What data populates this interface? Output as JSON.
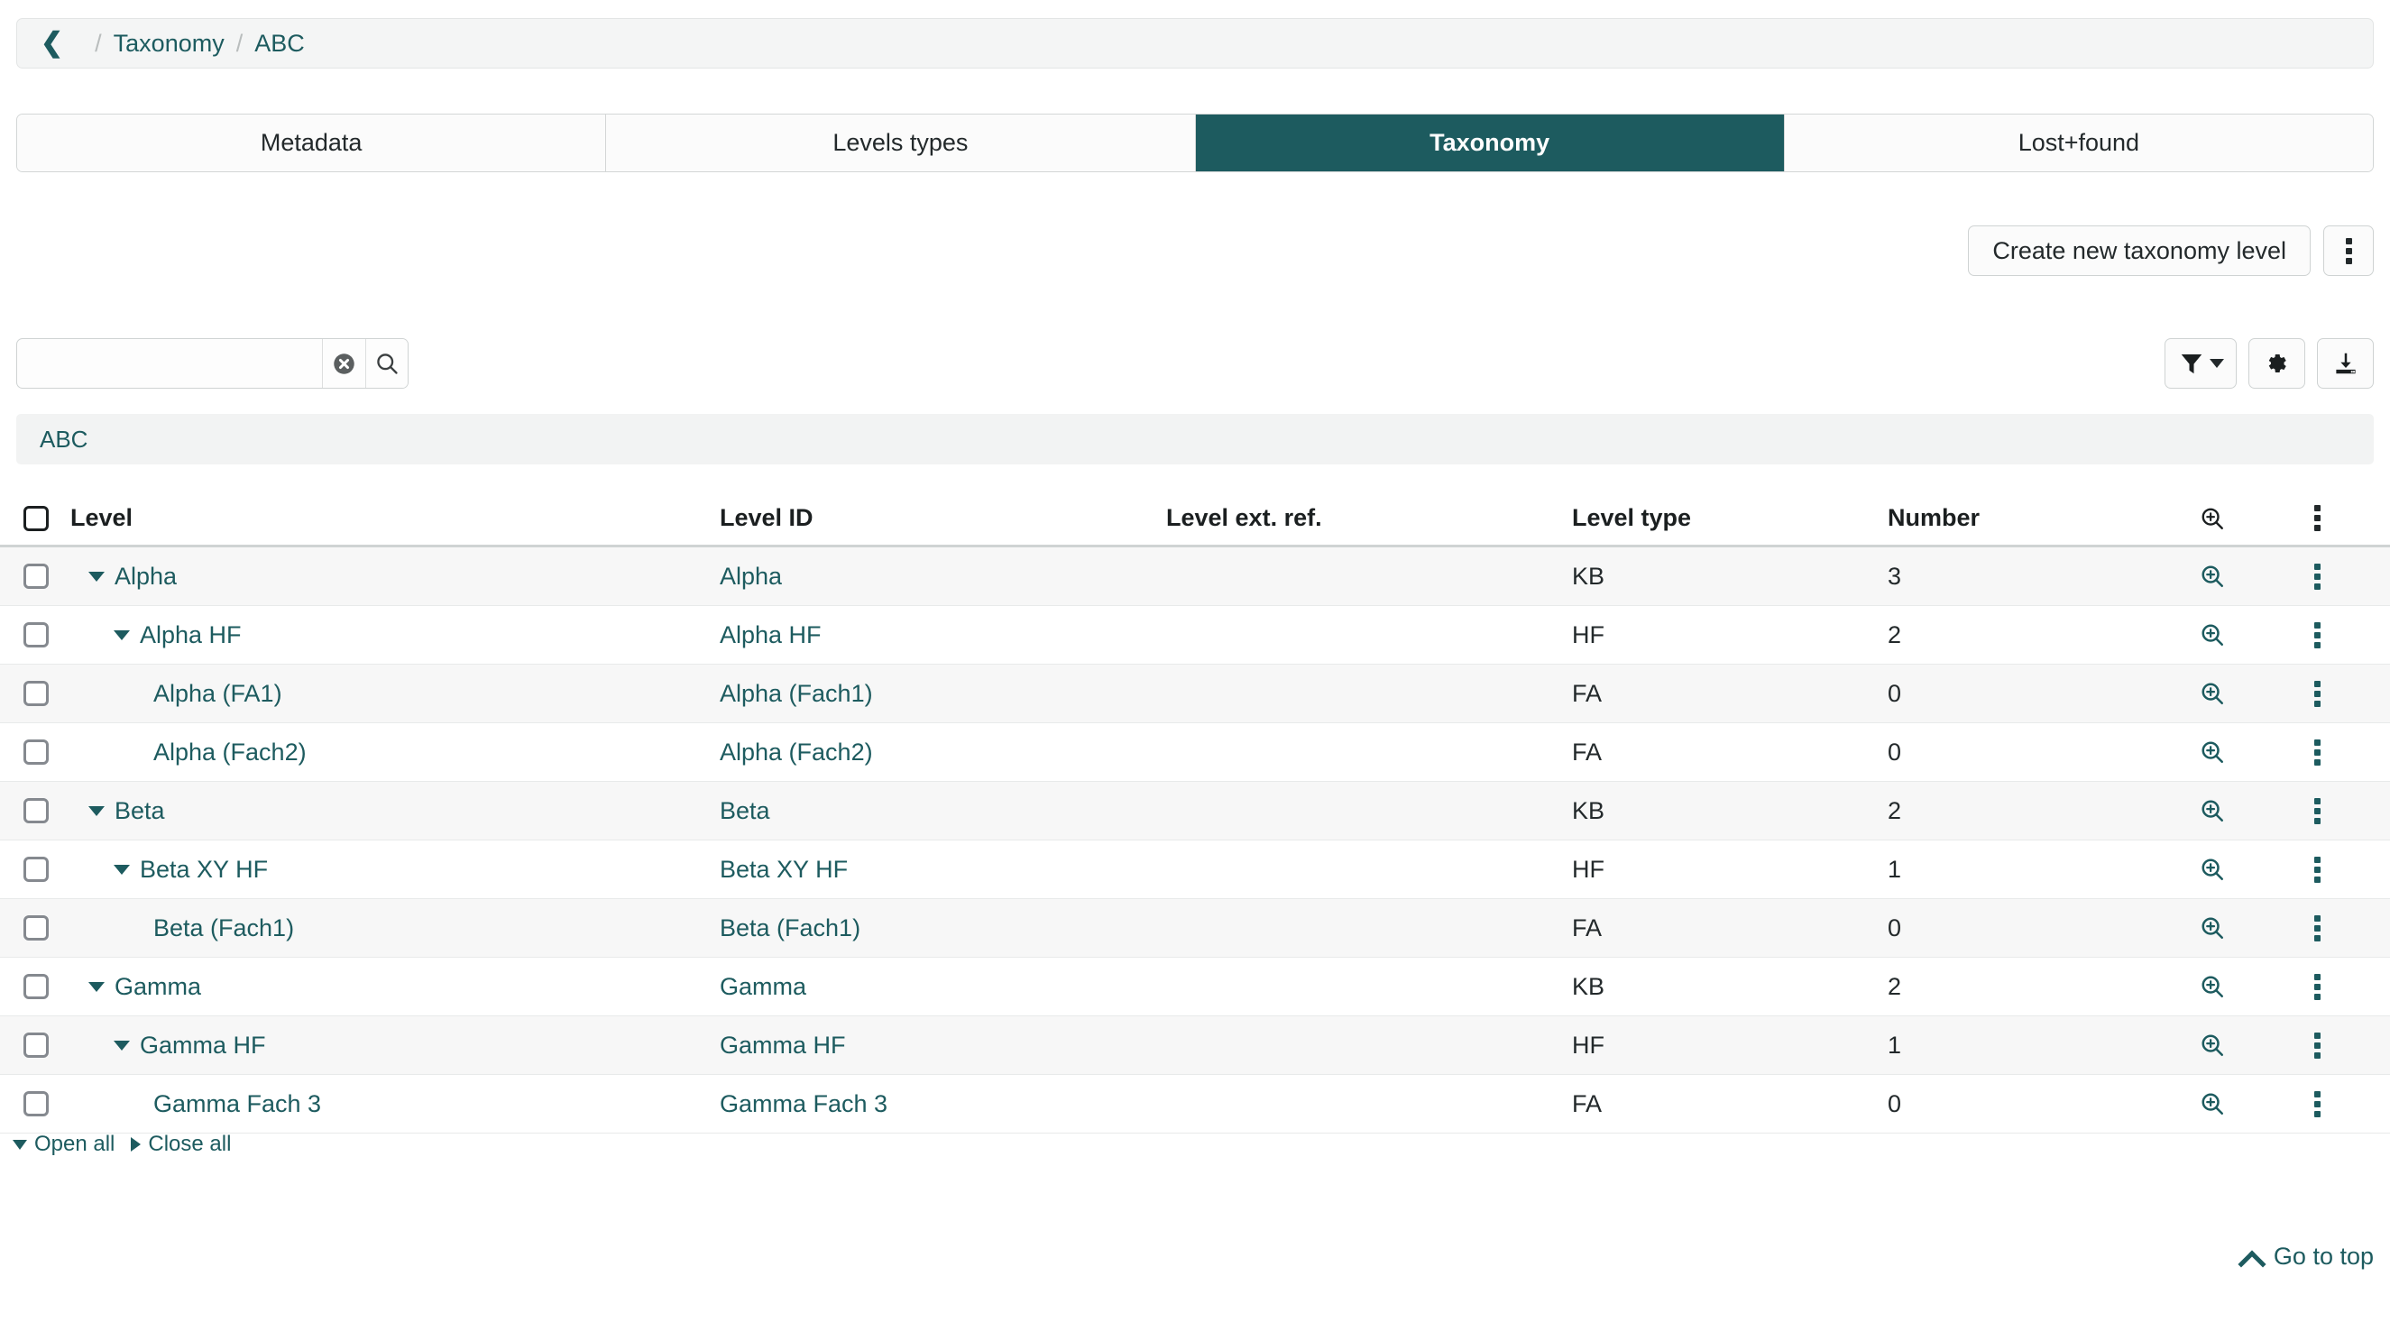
{
  "colors": {
    "accent": "#1d5b5f",
    "active_tab_bg": "#1d5b5f",
    "row_stripe": "#f7f7f7",
    "scope_bar_bg": "#f2f3f3",
    "breadcrumb_bg": "#f4f5f5"
  },
  "breadcrumb": {
    "back_icon": "chevron-left-icon",
    "separator": "/",
    "items": [
      {
        "label": "Taxonomy"
      },
      {
        "label": "ABC"
      }
    ]
  },
  "tabs": [
    {
      "label": "Metadata",
      "active": false
    },
    {
      "label": "Levels types",
      "active": false
    },
    {
      "label": "Taxonomy",
      "active": true
    },
    {
      "label": "Lost+found",
      "active": false
    }
  ],
  "action_bar": {
    "create_label": "Create new taxonomy level",
    "kebab_icon": "kebab-menu-icon"
  },
  "search": {
    "value": "",
    "placeholder": "",
    "clear_icon": "clear-circle-icon",
    "search_icon": "search-icon"
  },
  "tools": [
    {
      "name": "filter-button",
      "icon": "filter-icon"
    },
    {
      "name": "settings-button",
      "icon": "gear-icon"
    },
    {
      "name": "export-button",
      "icon": "download-icon"
    }
  ],
  "scope": {
    "label": "ABC"
  },
  "table": {
    "columns": [
      {
        "key": "level",
        "label": "Level"
      },
      {
        "key": "level_id",
        "label": "Level ID"
      },
      {
        "key": "level_ext_ref",
        "label": "Level ext. ref."
      },
      {
        "key": "level_type",
        "label": "Level type"
      },
      {
        "key": "number",
        "label": "Number"
      }
    ],
    "header_icons": {
      "zoom": "zoom-in-icon",
      "menu": "kebab-menu-icon"
    },
    "rows": [
      {
        "level": "Alpha",
        "depth": 0,
        "expandable": true,
        "level_id": "Alpha",
        "level_ext_ref": "",
        "level_type": "KB",
        "number": "3"
      },
      {
        "level": "Alpha HF",
        "depth": 1,
        "expandable": true,
        "level_id": "Alpha HF",
        "level_ext_ref": "",
        "level_type": "HF",
        "number": "2"
      },
      {
        "level": "Alpha (FA1)",
        "depth": 2,
        "expandable": false,
        "level_id": "Alpha (Fach1)",
        "level_ext_ref": "",
        "level_type": "FA",
        "number": "0"
      },
      {
        "level": "Alpha (Fach2)",
        "depth": 2,
        "expandable": false,
        "level_id": "Alpha (Fach2)",
        "level_ext_ref": "",
        "level_type": "FA",
        "number": "0"
      },
      {
        "level": "Beta",
        "depth": 0,
        "expandable": true,
        "level_id": "Beta",
        "level_ext_ref": "",
        "level_type": "KB",
        "number": "2"
      },
      {
        "level": "Beta XY HF",
        "depth": 1,
        "expandable": true,
        "level_id": "Beta XY HF",
        "level_ext_ref": "",
        "level_type": "HF",
        "number": "1"
      },
      {
        "level": "Beta (Fach1)",
        "depth": 2,
        "expandable": false,
        "level_id": "Beta (Fach1)",
        "level_ext_ref": "",
        "level_type": "FA",
        "number": "0"
      },
      {
        "level": "Gamma",
        "depth": 0,
        "expandable": true,
        "level_id": "Gamma",
        "level_ext_ref": "",
        "level_type": "KB",
        "number": "2"
      },
      {
        "level": "Gamma HF",
        "depth": 1,
        "expandable": true,
        "level_id": "Gamma HF",
        "level_ext_ref": "",
        "level_type": "HF",
        "number": "1"
      },
      {
        "level": "Gamma Fach 3",
        "depth": 2,
        "expandable": false,
        "level_id": "Gamma Fach 3",
        "level_ext_ref": "",
        "level_type": "FA",
        "number": "0"
      }
    ]
  },
  "tree_controls": {
    "open_all": "Open all",
    "close_all": "Close all"
  },
  "footer": {
    "go_to_top": "Go to top"
  }
}
